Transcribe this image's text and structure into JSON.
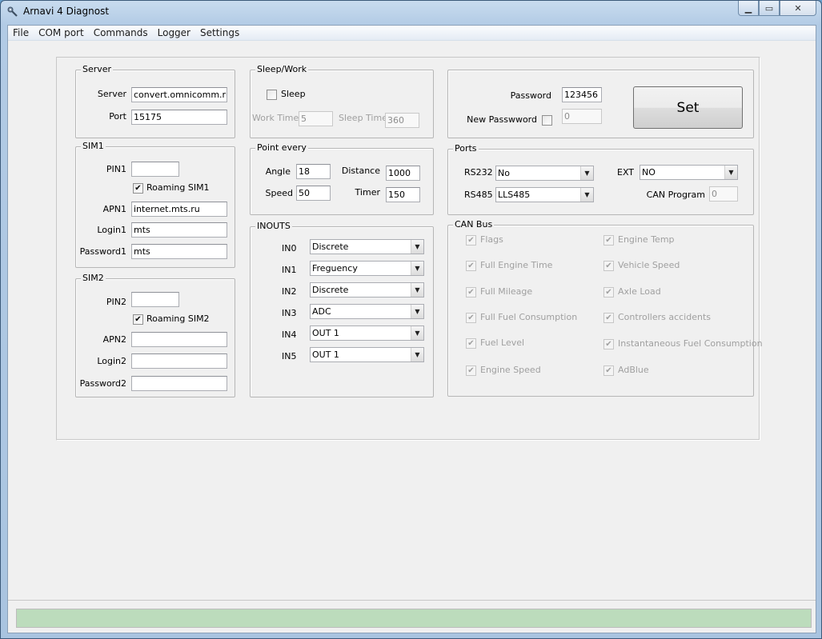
{
  "window": {
    "title": "Arnavi 4 Diagnost",
    "min": "▁",
    "max": "▭",
    "close": "✕"
  },
  "menu": [
    "File",
    "COM port",
    "Commands",
    "Logger",
    "Settings"
  ],
  "server": {
    "title": "Server",
    "server_label": "Server",
    "server_value": "convert.omnicomm.ru",
    "port_label": "Port",
    "port_value": "15175"
  },
  "sim1": {
    "title": "SIM1",
    "pin_label": "PIN1",
    "pin_value": "",
    "roaming_label": "Roaming SIM1",
    "roaming_checked": true,
    "apn_label": "APN1",
    "apn_value": "internet.mts.ru",
    "login_label": "Login1",
    "login_value": "mts",
    "password_label": "Password1",
    "password_value": "mts"
  },
  "sim2": {
    "title": "SIM2",
    "pin_label": "PIN2",
    "pin_value": "",
    "roaming_label": "Roaming SIM2",
    "roaming_checked": true,
    "apn_label": "APN2",
    "apn_value": "",
    "login_label": "Login2",
    "login_value": "",
    "password_label": "Password2",
    "password_value": ""
  },
  "sleep": {
    "title": "Sleep/Work",
    "sleep_label": "Sleep",
    "sleep_checked": false,
    "work_time_label": "Work Time",
    "work_time_value": "5",
    "sleep_time_label": "Sleep Time",
    "sleep_time_value": "360"
  },
  "point": {
    "title": "Point every",
    "angle_label": "Angle",
    "angle_value": "18",
    "distance_label": "Distance",
    "distance_value": "1000",
    "speed_label": "Speed",
    "speed_value": "50",
    "timer_label": "Timer",
    "timer_value": "150"
  },
  "inouts": {
    "title": "INOUTS",
    "rows": [
      {
        "label": "IN0",
        "value": "Discrete"
      },
      {
        "label": "IN1",
        "value": "Freguency"
      },
      {
        "label": "IN2",
        "value": "Discrete"
      },
      {
        "label": "IN3",
        "value": "ADC"
      },
      {
        "label": "IN4",
        "value": "OUT 1"
      },
      {
        "label": "IN5",
        "value": "OUT 1"
      }
    ]
  },
  "auth": {
    "password_label": "Password",
    "password_value": "123456",
    "new_password_label": "New Passwword",
    "new_password_checked": false,
    "new_password_value": "0",
    "set_label": "Set"
  },
  "ports": {
    "title": "Ports",
    "rs232_label": "RS232",
    "rs232_value": "No",
    "ext_label": "EXT",
    "ext_value": "NO",
    "rs485_label": "RS485",
    "rs485_value": "LLS485",
    "can_program_label": "CAN Program",
    "can_program_value": "0"
  },
  "canbus": {
    "title": "CAN Bus",
    "items": [
      "Flags",
      "Engine Temp",
      "Full Engine Time",
      "Vehicle Speed",
      "Full Mileage",
      "Axle Load",
      "Full Fuel Consumption",
      "Controllers accidents",
      "Fuel Level",
      "Instantaneous Fuel Consumption",
      "Engine Speed",
      "AdBlue"
    ]
  },
  "status": {
    "progress": 1.0
  }
}
